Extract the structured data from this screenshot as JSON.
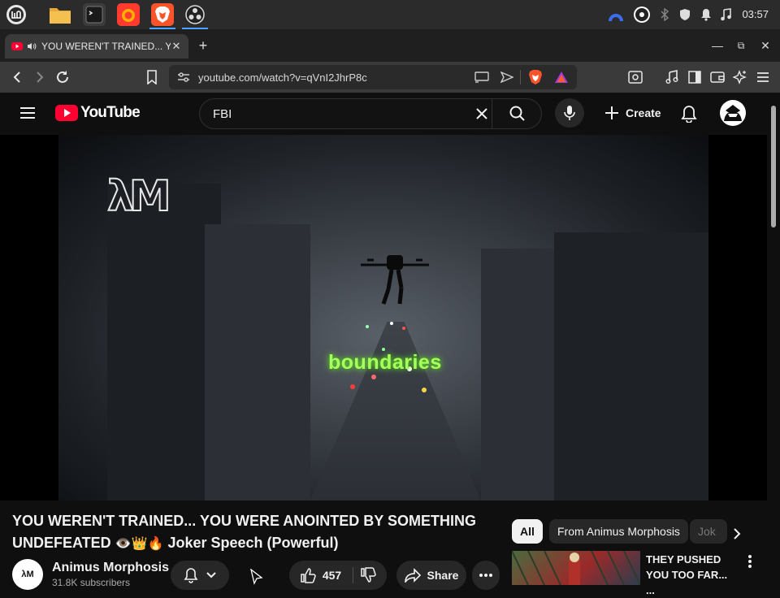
{
  "taskbar": {
    "clock": "03:57",
    "apps": [
      "mint-menu-icon",
      "files-icon",
      "terminal-icon",
      "firefox-icon",
      "brave-icon",
      "obs-icon"
    ]
  },
  "browser": {
    "tab_title": "YOU WEREN'T TRAINED... Y",
    "url": "youtube.com/watch?v=qVnI2JhrP8c",
    "accent": "#fb542b"
  },
  "youtube": {
    "logo_text": "YouTube",
    "search_value": "FBI",
    "create_label": "Create"
  },
  "video": {
    "caption": "boundaries",
    "watermark": "λM"
  },
  "details": {
    "title_line1": "YOU WEREN'T TRAINED... YOU WERE ANOINTED BY SOMETHING",
    "title_line2_start": "UNDEFEATED ",
    "title_emoji": "👁️👑🔥",
    "title_line2_end": " Joker Speech (Powerful)",
    "channel_name": "Animus Morphosis",
    "subscribers": "31.8K subscribers",
    "avatar_text": "λM",
    "likes": "457",
    "share_label": "Share"
  },
  "chips": [
    "All",
    "From Animus Morphosis",
    "Jok"
  ],
  "recommendation": {
    "title": "THEY PUSHED YOU TOO FAR... ..."
  }
}
